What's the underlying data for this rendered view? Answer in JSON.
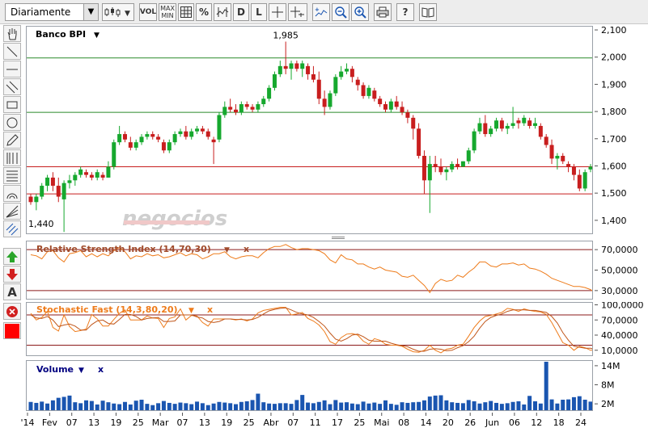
{
  "toolbar": {
    "period_select": "Diariamente",
    "vol_label": "VOL",
    "maxmin_label_top": "MAX",
    "maxmin_label_bottom": "MIN",
    "percent_label": "%",
    "d_label": "D",
    "l_label": "L",
    "question_label": "?"
  },
  "sidebar": {
    "text_tool_label": "A"
  },
  "colors": {
    "up_candle": "#16a82e",
    "down_candle": "#c81e1e",
    "grid_green": "#2a8a2a",
    "grid_red": "#c81e1e",
    "indicator_line": "#ee7b1a",
    "stoch_d_line": "#c0561a",
    "volume_bar": "#1a55b0",
    "title_navy": "#000080"
  },
  "watermark": "negocios",
  "chart_data": [
    {
      "type": "candlestick",
      "title": "Banco BPI",
      "x_labels": [
        "'14",
        "Fev",
        "07",
        "13",
        "19",
        "25",
        "Mar",
        "07",
        "13",
        "19",
        "25",
        "Abr",
        "07",
        "11",
        "17",
        "25",
        "Mai",
        "08",
        "14",
        "20",
        "26",
        "Jun",
        "06",
        "12",
        "18",
        "24"
      ],
      "y_ticks": [
        "2,100",
        "2,000",
        "1,900",
        "1,800",
        "1,700",
        "1,600",
        "1,500",
        "1,400"
      ],
      "ylim": [
        1.355,
        2.115
      ],
      "high_label": "1,985",
      "low_label": "1,440",
      "reference_lines": [
        {
          "value": 2.0,
          "color": "green"
        },
        {
          "value": 1.8,
          "color": "green"
        },
        {
          "value": 1.6,
          "color": "red"
        },
        {
          "value": 1.5,
          "color": "red"
        }
      ],
      "candles": [
        [
          1.49,
          1.5,
          1.46,
          1.47
        ],
        [
          1.47,
          1.5,
          1.44,
          1.49
        ],
        [
          1.49,
          1.54,
          1.48,
          1.53
        ],
        [
          1.53,
          1.57,
          1.51,
          1.56
        ],
        [
          1.56,
          1.58,
          1.51,
          1.53
        ],
        [
          1.53,
          1.56,
          1.47,
          1.49
        ],
        [
          1.48,
          1.55,
          1.36,
          1.54
        ],
        [
          1.54,
          1.57,
          1.52,
          1.55
        ],
        [
          1.55,
          1.58,
          1.53,
          1.57
        ],
        [
          1.57,
          1.6,
          1.56,
          1.59
        ],
        [
          1.58,
          1.59,
          1.56,
          1.57
        ],
        [
          1.57,
          1.58,
          1.55,
          1.56
        ],
        [
          1.56,
          1.59,
          1.55,
          1.58
        ],
        [
          1.57,
          1.58,
          1.55,
          1.56
        ],
        [
          1.56,
          1.62,
          1.56,
          1.6
        ],
        [
          1.6,
          1.7,
          1.59,
          1.69
        ],
        [
          1.69,
          1.75,
          1.68,
          1.72
        ],
        [
          1.72,
          1.73,
          1.69,
          1.7
        ],
        [
          1.69,
          1.71,
          1.66,
          1.67
        ],
        [
          1.67,
          1.7,
          1.66,
          1.69
        ],
        [
          1.69,
          1.72,
          1.68,
          1.71
        ],
        [
          1.71,
          1.73,
          1.7,
          1.72
        ],
        [
          1.72,
          1.73,
          1.7,
          1.71
        ],
        [
          1.71,
          1.72,
          1.69,
          1.7
        ],
        [
          1.69,
          1.7,
          1.65,
          1.66
        ],
        [
          1.66,
          1.7,
          1.65,
          1.69
        ],
        [
          1.69,
          1.73,
          1.68,
          1.72
        ],
        [
          1.72,
          1.74,
          1.71,
          1.73
        ],
        [
          1.73,
          1.75,
          1.7,
          1.71
        ],
        [
          1.71,
          1.74,
          1.7,
          1.73
        ],
        [
          1.73,
          1.75,
          1.72,
          1.74
        ],
        [
          1.74,
          1.75,
          1.72,
          1.73
        ],
        [
          1.73,
          1.74,
          1.7,
          1.71
        ],
        [
          1.7,
          1.71,
          1.61,
          1.69
        ],
        [
          1.7,
          1.8,
          1.69,
          1.79
        ],
        [
          1.79,
          1.84,
          1.78,
          1.82
        ],
        [
          1.82,
          1.85,
          1.8,
          1.81
        ],
        [
          1.81,
          1.83,
          1.79,
          1.8
        ],
        [
          1.8,
          1.84,
          1.79,
          1.83
        ],
        [
          1.83,
          1.84,
          1.81,
          1.82
        ],
        [
          1.82,
          1.83,
          1.8,
          1.81
        ],
        [
          1.81,
          1.84,
          1.8,
          1.83
        ],
        [
          1.83,
          1.86,
          1.82,
          1.85
        ],
        [
          1.85,
          1.9,
          1.84,
          1.89
        ],
        [
          1.89,
          1.95,
          1.88,
          1.94
        ],
        [
          1.94,
          1.99,
          1.93,
          1.97
        ],
        [
          1.97,
          2.06,
          1.94,
          1.96
        ],
        [
          1.96,
          1.99,
          1.92,
          1.98
        ],
        [
          1.98,
          1.99,
          1.95,
          1.96
        ],
        [
          1.96,
          1.99,
          1.93,
          1.98
        ],
        [
          1.97,
          1.98,
          1.92,
          1.94
        ],
        [
          1.94,
          1.97,
          1.91,
          1.92
        ],
        [
          1.92,
          1.95,
          1.83,
          1.85
        ],
        [
          1.85,
          1.88,
          1.79,
          1.82
        ],
        [
          1.82,
          1.88,
          1.81,
          1.87
        ],
        [
          1.87,
          1.94,
          1.86,
          1.93
        ],
        [
          1.93,
          1.97,
          1.92,
          1.95
        ],
        [
          1.95,
          1.98,
          1.94,
          1.96
        ],
        [
          1.96,
          1.97,
          1.91,
          1.93
        ],
        [
          1.92,
          1.93,
          1.88,
          1.9
        ],
        [
          1.9,
          1.91,
          1.85,
          1.86
        ],
        [
          1.86,
          1.9,
          1.85,
          1.89
        ],
        [
          1.88,
          1.89,
          1.84,
          1.85
        ],
        [
          1.85,
          1.86,
          1.82,
          1.83
        ],
        [
          1.83,
          1.84,
          1.8,
          1.81
        ],
        [
          1.81,
          1.85,
          1.8,
          1.84
        ],
        [
          1.84,
          1.86,
          1.81,
          1.82
        ],
        [
          1.82,
          1.84,
          1.79,
          1.8
        ],
        [
          1.8,
          1.81,
          1.76,
          1.78
        ],
        [
          1.78,
          1.79,
          1.7,
          1.74
        ],
        [
          1.74,
          1.76,
          1.63,
          1.64
        ],
        [
          1.64,
          1.66,
          1.5,
          1.55
        ],
        [
          1.55,
          1.64,
          1.43,
          1.61
        ],
        [
          1.61,
          1.64,
          1.58,
          1.6
        ],
        [
          1.6,
          1.63,
          1.57,
          1.58
        ],
        [
          1.58,
          1.6,
          1.55,
          1.59
        ],
        [
          1.59,
          1.62,
          1.58,
          1.61
        ],
        [
          1.61,
          1.63,
          1.59,
          1.6
        ],
        [
          1.6,
          1.62,
          1.6,
          1.62
        ],
        [
          1.62,
          1.67,
          1.61,
          1.66
        ],
        [
          1.66,
          1.74,
          1.65,
          1.73
        ],
        [
          1.73,
          1.78,
          1.72,
          1.76
        ],
        [
          1.76,
          1.79,
          1.71,
          1.72
        ],
        [
          1.72,
          1.75,
          1.71,
          1.74
        ],
        [
          1.74,
          1.78,
          1.73,
          1.77
        ],
        [
          1.77,
          1.78,
          1.73,
          1.74
        ],
        [
          1.74,
          1.76,
          1.72,
          1.75
        ],
        [
          1.75,
          1.82,
          1.74,
          1.76
        ],
        [
          1.77,
          1.78,
          1.74,
          1.76
        ],
        [
          1.76,
          1.79,
          1.75,
          1.78
        ],
        [
          1.77,
          1.78,
          1.74,
          1.75
        ],
        [
          1.75,
          1.78,
          1.74,
          1.76
        ],
        [
          1.75,
          1.76,
          1.7,
          1.71
        ],
        [
          1.71,
          1.72,
          1.67,
          1.68
        ],
        [
          1.68,
          1.7,
          1.61,
          1.63
        ],
        [
          1.63,
          1.65,
          1.59,
          1.64
        ],
        [
          1.64,
          1.65,
          1.61,
          1.62
        ],
        [
          1.61,
          1.62,
          1.58,
          1.6
        ],
        [
          1.6,
          1.61,
          1.55,
          1.57
        ],
        [
          1.57,
          1.59,
          1.51,
          1.52
        ],
        [
          1.52,
          1.59,
          1.51,
          1.58
        ],
        [
          1.59,
          1.61,
          1.58,
          1.6
        ]
      ]
    },
    {
      "type": "line",
      "title": "Relative Strength Index (14,70,30)",
      "y_ticks": [
        "70,0000",
        "50,0000",
        "30,0000"
      ],
      "ylim": [
        22,
        78
      ],
      "reference_lines": [
        70,
        30
      ],
      "series": [
        {
          "values": [
            65,
            64,
            61,
            68,
            69,
            62,
            58,
            66,
            67,
            69,
            63,
            66,
            63,
            66,
            64,
            69,
            72,
            68,
            61,
            64,
            63,
            66,
            64,
            65,
            62,
            63,
            65,
            67,
            64,
            66,
            65,
            61,
            63,
            66,
            66,
            68,
            63,
            61,
            63,
            64,
            64,
            62,
            67,
            71,
            73,
            73,
            75,
            72,
            70,
            71,
            71,
            70,
            69,
            66,
            60,
            57,
            65,
            61,
            60,
            56,
            56,
            53,
            51,
            53,
            50,
            49,
            48,
            44,
            43,
            45,
            40,
            35,
            28,
            37,
            41,
            39,
            40,
            45,
            43,
            48,
            52,
            58,
            58,
            54,
            53,
            56,
            56,
            57,
            55,
            56,
            52,
            51,
            49,
            46,
            42,
            40,
            38,
            36,
            34,
            34,
            33,
            31,
            27,
            33,
            36
          ]
        }
      ]
    },
    {
      "type": "line",
      "title": "Stochastic Fast (14,3,80,20)",
      "y_ticks": [
        "100,0000",
        "70,0000",
        "40,0000",
        "10,0000"
      ],
      "ylim": [
        0,
        104
      ],
      "reference_lines": [
        80,
        20
      ],
      "series": [
        {
          "values": [
            83,
            70,
            75,
            87,
            55,
            48,
            80,
            57,
            47,
            49,
            52,
            81,
            72,
            58,
            58,
            71,
            83,
            90,
            70,
            70,
            70,
            78,
            74,
            73,
            55,
            73,
            76,
            92,
            70,
            79,
            78,
            65,
            58,
            72,
            72,
            72,
            72,
            70,
            72,
            68,
            72,
            84,
            89,
            91,
            93,
            95,
            95,
            80,
            82,
            85,
            73,
            68,
            60,
            47,
            27,
            22,
            35,
            42,
            43,
            40,
            28,
            22,
            33,
            30,
            22,
            20,
            20,
            18,
            12,
            7,
            6,
            10,
            20,
            10,
            5,
            12,
            14,
            20,
            22,
            38,
            55,
            68,
            77,
            79,
            82,
            85,
            93,
            91,
            87,
            92,
            89,
            87,
            86,
            81,
            65,
            45,
            25,
            20,
            10,
            18,
            15,
            10,
            10,
            12,
            30
          ]
        },
        {
          "values": [
            80,
            74,
            73,
            77,
            70,
            57,
            60,
            62,
            58,
            50,
            50,
            61,
            68,
            70,
            63,
            62,
            71,
            81,
            81,
            77,
            70,
            73,
            74,
            75,
            67,
            67,
            68,
            80,
            80,
            80,
            76,
            74,
            67,
            65,
            67,
            72,
            72,
            71,
            71,
            70,
            71,
            75,
            82,
            88,
            91,
            93,
            94,
            90,
            85,
            82,
            80,
            75,
            67,
            58,
            44,
            32,
            28,
            33,
            40,
            42,
            37,
            30,
            28,
            28,
            28,
            24,
            21,
            19,
            17,
            12,
            8,
            8,
            12,
            13,
            12,
            9,
            10,
            15,
            19,
            27,
            38,
            54,
            67,
            75,
            79,
            82,
            87,
            90,
            90,
            90,
            89,
            89,
            87,
            85,
            77,
            64,
            45,
            30,
            18,
            16,
            14,
            14,
            11,
            11,
            17
          ]
        }
      ]
    },
    {
      "type": "bar",
      "title": "Volume",
      "y_ticks": [
        "14M",
        "8M",
        "2M"
      ],
      "ylim": [
        0,
        15.5
      ],
      "values": [
        2.6,
        2.3,
        2.7,
        2.1,
        3.1,
        3.9,
        4.2,
        4.6,
        2.5,
        2.2,
        3.1,
        2.9,
        1.8,
        3.0,
        2.5,
        2.1,
        1.9,
        2.6,
        1.8,
        3.0,
        3.3,
        2.0,
        1.6,
        2.2,
        2.9,
        2.3,
        2.0,
        2.4,
        2.2,
        1.9,
        2.7,
        2.2,
        1.6,
        2.1,
        2.6,
        2.4,
        2.2,
        1.9,
        2.6,
        2.8,
        3.2,
        5.2,
        2.5,
        2.1,
        2.0,
        2.2,
        2.2,
        2.0,
        3.2,
        4.8,
        2.4,
        2.2,
        2.6,
        3.1,
        1.9,
        3.2,
        2.4,
        2.5,
        2.1,
        1.9,
        2.7,
        2.1,
        2.4,
        2.0,
        3.1,
        2.0,
        1.7,
        2.5,
        2.3,
        2.5,
        2.6,
        3.1,
        4.3,
        4.6,
        4.7,
        3.1,
        2.5,
        2.3,
        2.2,
        3.2,
        2.8,
        2.1,
        2.5,
        2.9,
        2.3,
        2.0,
        2.2,
        2.6,
        2.8,
        1.8,
        4.5,
        2.8,
        2.1,
        16.5,
        3.4,
        2.1,
        3.3,
        3.4,
        4.1,
        4.4,
        3.3,
        2.7,
        2.1,
        3.5,
        2.6
      ]
    }
  ]
}
